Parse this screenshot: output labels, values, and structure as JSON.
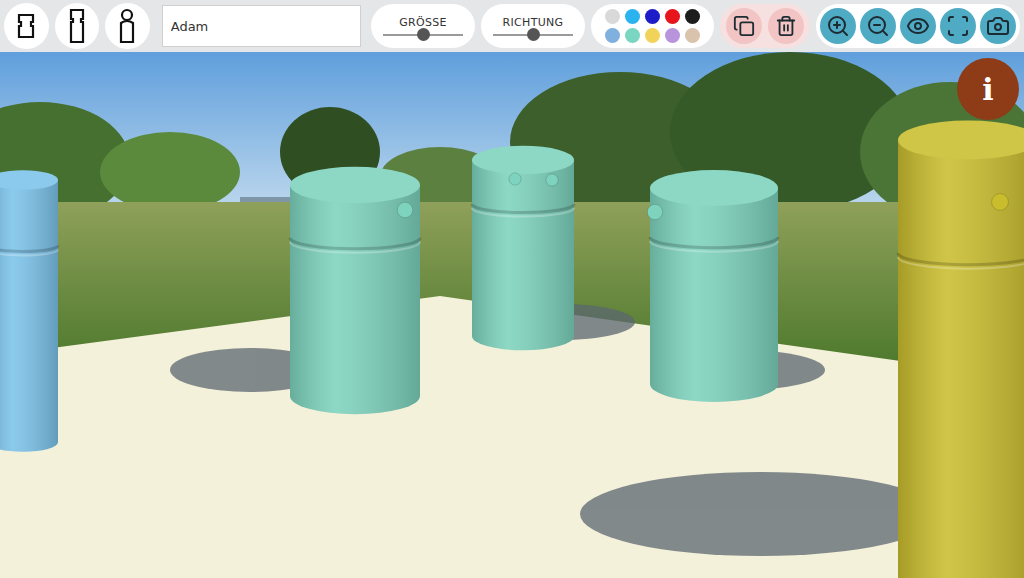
{
  "toolbar": {
    "name_field": {
      "value": "Adam"
    },
    "sliders": [
      {
        "label": "GRÖSSE",
        "level": 0.5
      },
      {
        "label": "RICHTUNG",
        "level": 0.5
      }
    ],
    "palette": [
      {
        "color": "#d9d9d9"
      },
      {
        "color": "#2bb3f0"
      },
      {
        "color": "#1c1cc8"
      },
      {
        "color": "#e8141c"
      },
      {
        "color": "#1c1c1c"
      },
      {
        "color": "#7fb0de"
      },
      {
        "color": "#7ad6c0"
      },
      {
        "color": "#f2d35a"
      },
      {
        "color": "#b894dc"
      },
      {
        "color": "#d9c3ad"
      }
    ]
  },
  "info_button": {
    "label": "i"
  },
  "figures": [
    {
      "color": "#7cc3ea"
    },
    {
      "color": "#7dd3bd"
    },
    {
      "color": "#7dd3bd"
    },
    {
      "color": "#7dd3bd"
    },
    {
      "color": "#c9bd2e"
    }
  ]
}
